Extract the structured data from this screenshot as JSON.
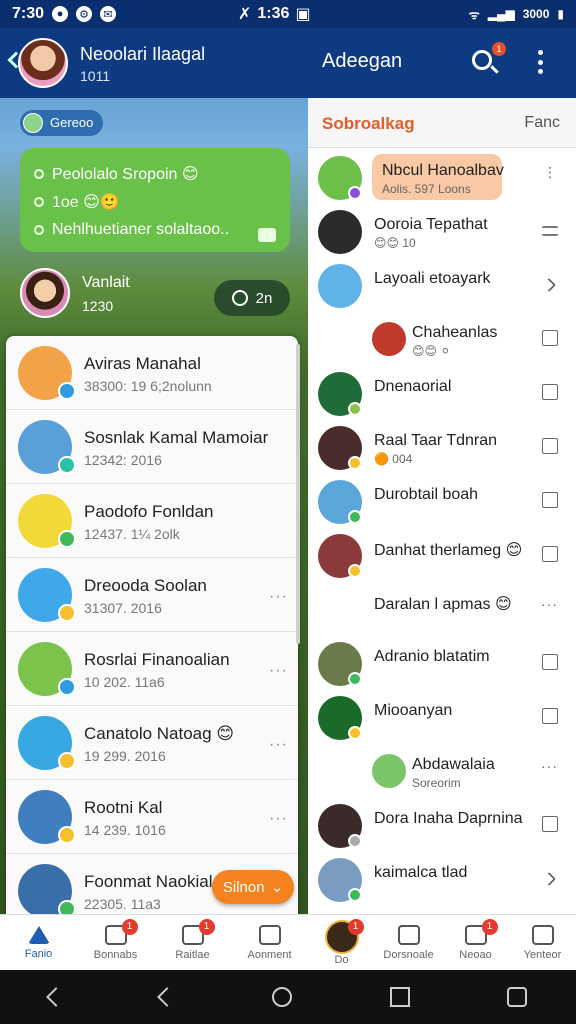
{
  "statusbar": {
    "time_left": "7:30",
    "time_mid": "1:36",
    "battery": "3000",
    "icons": [
      "notification-icon",
      "settings-icon",
      "message-icon",
      "signal-icon",
      "battery-icon"
    ]
  },
  "left": {
    "header_name": "Neoolari Ilaagal",
    "header_sub": "1011",
    "group_chip": "Gereoo",
    "bubble_lines": [
      "Peololalo Sropoin 😊",
      "1oe 😊🙂",
      "Nehlhuetianer solaltaoo.."
    ],
    "sender_name": "Vanlait",
    "sender_time": "1230",
    "timer_label": "2n",
    "contacts": [
      {
        "name": "Aviras Manahal",
        "sub": "38300: 19 6;2nolunn",
        "av": "#f2a348",
        "badge": "#2d9be0",
        "more": false
      },
      {
        "name": "Sosnlak Kamal Mamoiar",
        "sub": "12342: 2016",
        "av": "#5aa0d8",
        "badge": "#29c1a8",
        "more": false
      },
      {
        "name": "Paodofo Fonldan",
        "sub": "12437. 1¼ 2olk",
        "av": "#f2d93a",
        "badge": "#3cba5a",
        "more": false
      },
      {
        "name": "Dreooda Soolan",
        "sub": "31307. 2016",
        "av": "#3fa8e8",
        "badge": "#f5c02b",
        "more": true
      },
      {
        "name": "Rosrlai Finanoalian",
        "sub": "10 202. 11a6",
        "av": "#7bc34a",
        "badge": "#2d9be0",
        "more": true
      },
      {
        "name": "Canatolo Natoag 😊",
        "sub": "19 299. 2016",
        "av": "#36a7e0",
        "badge": "#f5c02b",
        "more": true
      },
      {
        "name": "Rootni Kal",
        "sub": "14 239. 1016",
        "av": "#3f7fc0",
        "badge": "#f5c02b",
        "more": true
      },
      {
        "name": "Foonmat Naokial",
        "sub": "22305. 11a3",
        "av": "#3a6ea8",
        "badge": "#3cba5a",
        "more": false
      }
    ],
    "float_button": "Silnon",
    "tabs": [
      {
        "label": "Fanio",
        "name": "tab-home",
        "badge": ""
      },
      {
        "label": "Bonnabs",
        "name": "tab-bonnabs",
        "badge": "1"
      },
      {
        "label": "Raitlae",
        "name": "tab-raitlae",
        "badge": "1"
      },
      {
        "label": "Aonment",
        "name": "tab-aonment",
        "badge": ""
      }
    ]
  },
  "right": {
    "title": "Adeegan",
    "search_badge": "1",
    "sub_title": "Sobroalkag",
    "sub_action": "Fanc",
    "rows": [
      {
        "name": "Nbcul Hanoalbav",
        "sub": "Aolis. 597 Loons",
        "av": "#6bbf4a",
        "bd": "#8a4fd2",
        "acc": "dots",
        "hl": true
      },
      {
        "name": "Ooroia Tepathat",
        "sub": "😊😊 10",
        "av": "#2b2b2b",
        "bd": "",
        "acc": "lines",
        "hl": false
      },
      {
        "name": "Layoali etoayark",
        "sub": "",
        "av": "#5fb3e6",
        "bd": "",
        "acc": "chev",
        "hl": false
      },
      {
        "name": "Chaheanlas",
        "sub": "😊😊 ⚪",
        "av": "#c0392b",
        "bd": "",
        "acc": "box",
        "hl": false,
        "indent": true
      },
      {
        "name": "Dnenaorial",
        "sub": "",
        "av": "#1f6b3a",
        "bd": "#8bc34a",
        "acc": "box",
        "hl": false
      },
      {
        "name": "Raal Taar Tdnran",
        "sub": "🟠 004",
        "av": "#4a2c2c",
        "bd": "#f5c02b",
        "acc": "box",
        "hl": false
      },
      {
        "name": "Durobtail boah",
        "sub": "",
        "av": "#5aa6d8",
        "bd": "#3cba5a",
        "acc": "box",
        "hl": false
      },
      {
        "name": "Danhat therlameg 😊",
        "sub": "",
        "av": "#8a3a3a",
        "bd": "#f5c02b",
        "acc": "box",
        "hl": false
      },
      {
        "name": "Daralan l apmas 😊",
        "sub": "",
        "av": "",
        "bd": "",
        "acc": "dots",
        "hl": false
      },
      {
        "name": "Adranio blatatim",
        "sub": "",
        "av": "#6a7a4a",
        "bd": "#3cba5a",
        "acc": "box",
        "hl": false
      },
      {
        "name": "Miooanyan",
        "sub": "",
        "av": "#1a6b2a",
        "bd": "#f5c02b",
        "acc": "box",
        "hl": false
      },
      {
        "name": "Abdawalaia",
        "sub": "Soreorim",
        "av": "#7cc46a",
        "bd": "",
        "acc": "dots",
        "hl": false,
        "indent": true
      },
      {
        "name": "Dora Inaha Daprnina",
        "sub": "",
        "av": "#3a2a2a",
        "bd": "#aaaaaa",
        "acc": "box",
        "hl": false
      },
      {
        "name": "kaimalca tlad",
        "sub": "",
        "av": "#7a9cc0",
        "bd": "#3cba5a",
        "acc": "chev",
        "hl": false
      }
    ],
    "tabs": [
      {
        "label": "Do",
        "name": "tab-profile",
        "badge": "1"
      },
      {
        "label": "Dorsnoale",
        "name": "tab-dorsnoale",
        "badge": ""
      },
      {
        "label": "Neoao",
        "name": "tab-neoao",
        "badge": "1"
      },
      {
        "label": "Yenteor",
        "name": "tab-yenteor",
        "badge": ""
      }
    ]
  }
}
